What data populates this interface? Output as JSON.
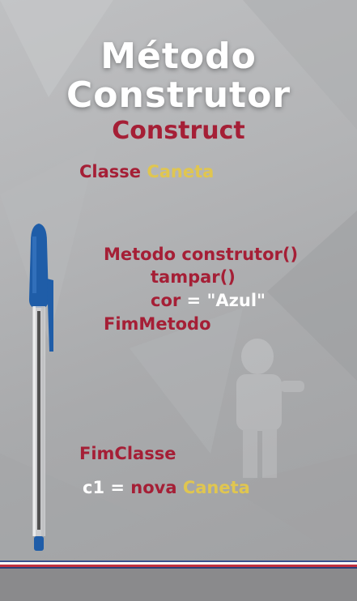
{
  "title": {
    "line1": "Método",
    "line2": "Construtor"
  },
  "subtitle": "Construct",
  "code": {
    "classe_kw": "Classe",
    "classe_name": "Caneta",
    "metodo_kw": "Metodo",
    "metodo_name": "construtor()",
    "tampar": "tampar()",
    "cor_var": "cor",
    "cor_eq": " = ",
    "cor_val": "\"Azul\"",
    "fim_metodo": "FimMetodo",
    "fim_classe": "FimClasse",
    "inst_var": "c1",
    "inst_eq": " = ",
    "inst_nova": "nova",
    "inst_class": "Caneta"
  },
  "colors": {
    "keyword": "#a51f36",
    "identifier": "#e0c650",
    "text": "#ffffff"
  }
}
